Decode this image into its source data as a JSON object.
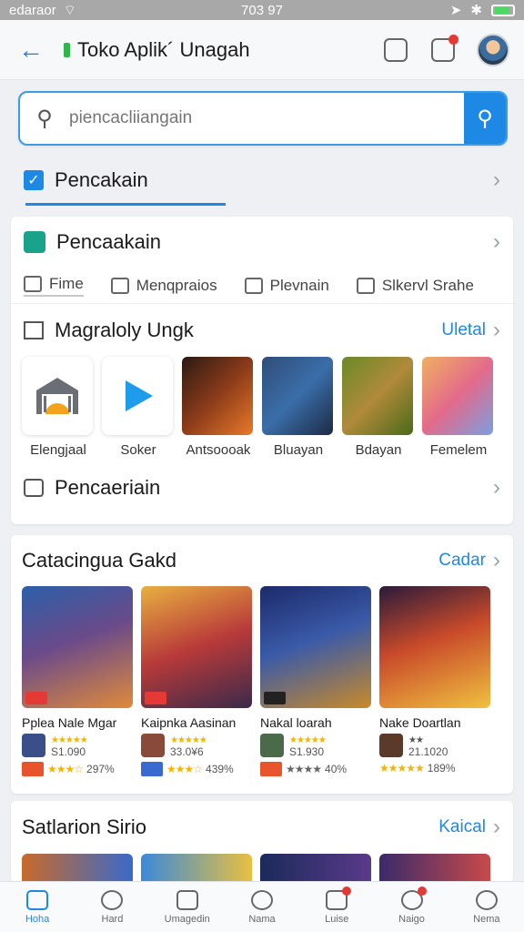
{
  "status_bar": {
    "carrier": "edaraor",
    "time": "703 97"
  },
  "header": {
    "title": "Toko Aplik´ Unagah"
  },
  "search": {
    "placeholder": "piencacliiangain"
  },
  "top_category": {
    "label": "Pencakain"
  },
  "card1": {
    "row_label": "Pencaakain",
    "filters": [
      "Fime",
      "Menqpraios",
      "Plevnain",
      "Slkervl Srahe"
    ],
    "section_title": "Magraloly Ungk",
    "section_link": "Uletal",
    "apps": [
      "Elengjaal",
      "Soker",
      "Antsoooak",
      "Bluayan",
      "Bdayan",
      "Femelem"
    ],
    "bottom_label": "Pencaeriain"
  },
  "card2": {
    "title": "Catacingua Gakd",
    "link": "Cadar",
    "games": [
      {
        "title": "Pplea Nale Mgar",
        "price": "S1.090",
        "rating": "297%"
      },
      {
        "title": "Kaipnka Aasinan",
        "price": "33.0¥6",
        "rating": "439%"
      },
      {
        "title": "Nakal loarah",
        "price": "S1.930",
        "rating": "40%"
      },
      {
        "title": "Nake Doartlan",
        "price": "21.1020",
        "rating": "189%"
      }
    ]
  },
  "card3": {
    "title": "Satlarion Sirio",
    "link": "Kaical"
  },
  "nav": [
    "Hoha",
    "Hard",
    "Umagedin",
    "Nama",
    "Luise",
    "Naigo",
    "Nema"
  ],
  "colors": {
    "accent": "#1e88e5",
    "badge": "#e53935",
    "star": "#f4b400"
  }
}
